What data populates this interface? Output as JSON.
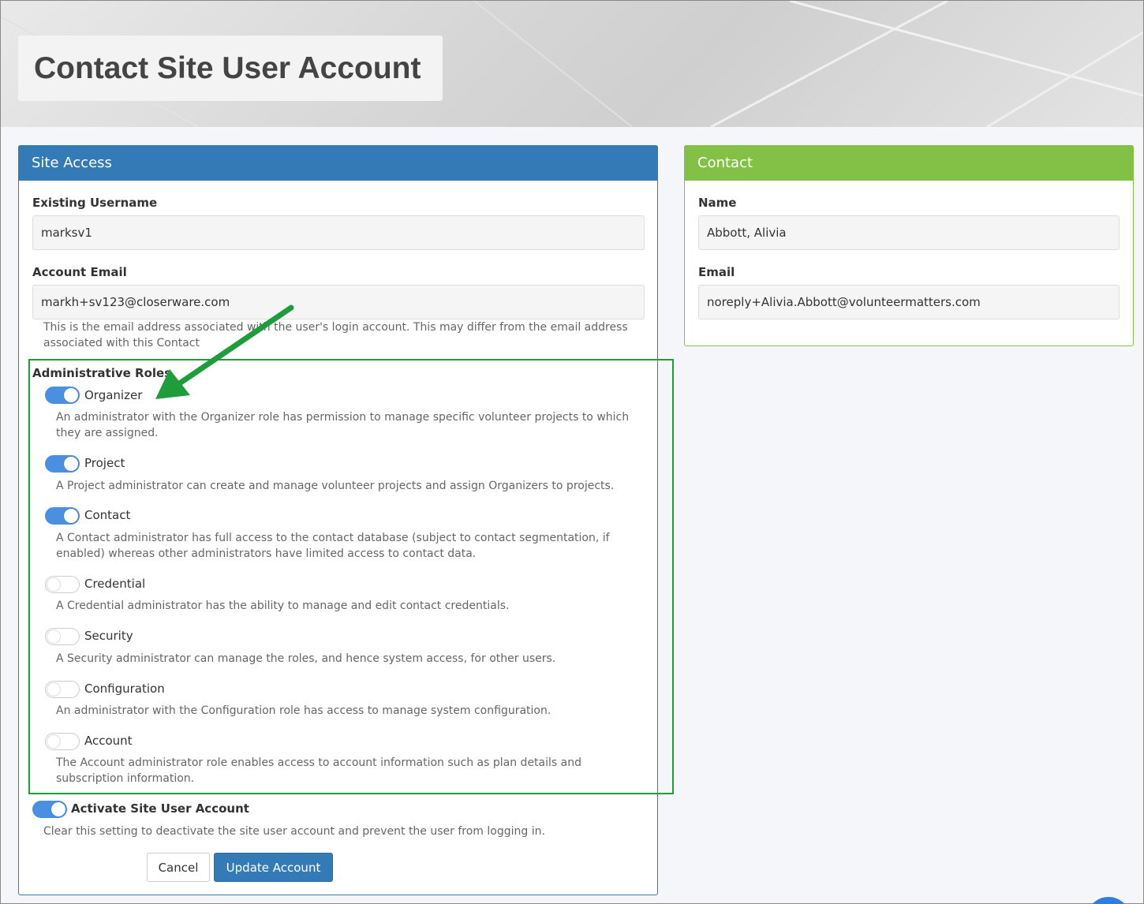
{
  "page_title": "Contact Site User Account",
  "site_access": {
    "header": "Site Access",
    "username_label": "Existing Username",
    "username_value": "marksv1",
    "email_label": "Account Email",
    "email_value": "markh+sv123@closerware.com",
    "email_help_line1": "This is the email address associated with the user's login account. This may differ from the email address",
    "email_help_line2": "associated with this Contact",
    "roles_label": "Administrative Roles",
    "roles": [
      {
        "name": "Organizer",
        "enabled": true,
        "desc1": "An administrator with the Organizer role has permission to manage specific volunteer projects to which",
        "desc2": "they are assigned."
      },
      {
        "name": "Project",
        "enabled": true,
        "desc1": "A Project administrator can create and manage volunteer projects and assign Organizers to projects.",
        "desc2": ""
      },
      {
        "name": "Contact",
        "enabled": true,
        "desc1": "A Contact administrator has full access to the contact database (subject to contact segmentation, if",
        "desc2": "enabled) whereas other administrators have limited access to contact data."
      },
      {
        "name": "Credential",
        "enabled": false,
        "desc1": "A Credential administrator has the ability to manage and edit contact credentials.",
        "desc2": ""
      },
      {
        "name": "Security",
        "enabled": false,
        "desc1": "A Security administrator can manage the roles, and hence system access, for other users.",
        "desc2": ""
      },
      {
        "name": "Configuration",
        "enabled": false,
        "desc1": "An administrator with the Configuration role has access to manage system configuration.",
        "desc2": ""
      },
      {
        "name": "Account",
        "enabled": false,
        "desc1": "The Account administrator role enables access to account information such as plan details and",
        "desc2": "subscription information."
      }
    ],
    "activate_label": "Activate Site User Account",
    "activate_enabled": true,
    "activate_help": "Clear this setting to deactivate the site user account and prevent the user from logging in.",
    "cancel_label": "Cancel",
    "update_label": "Update Account"
  },
  "contact": {
    "header": "Contact",
    "name_label": "Name",
    "name_value": "Abbott, Alivia",
    "email_label": "Email",
    "email_value": "noreply+Alivia.Abbott@volunteermatters.com"
  },
  "colors": {
    "site_header": "#337ab7",
    "contact_header": "#82c046",
    "toggle_on": "#4a8fe0",
    "annotation": "#1f9d3b"
  }
}
